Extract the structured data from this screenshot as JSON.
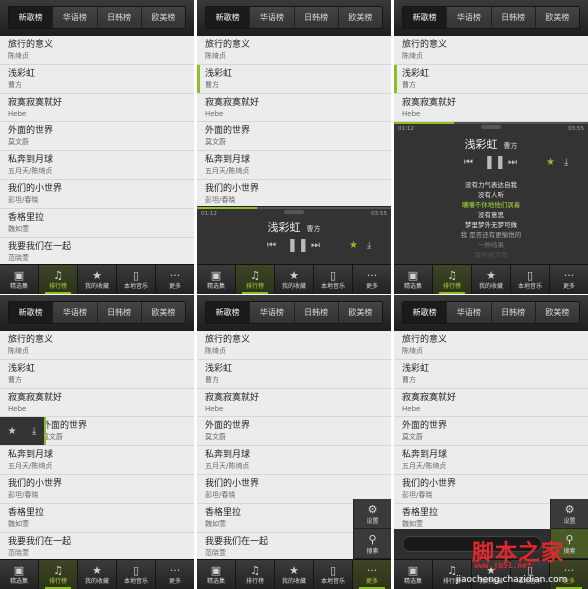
{
  "tabs": [
    "新歌榜",
    "华语榜",
    "日韩榜",
    "欧美榜"
  ],
  "active_tab": 0,
  "songs": [
    {
      "title": "旅行的意义",
      "artist": "陈绮贞"
    },
    {
      "title": "浅彩虹",
      "artist": "曹方"
    },
    {
      "title": "寂寞寂寞就好",
      "artist": "Hebe"
    },
    {
      "title": "外面的世界",
      "artist": "莫文蔚"
    },
    {
      "title": "私奔到月球",
      "artist": "五月天/陈绮贞"
    },
    {
      "title": "我们的小世界",
      "artist": "彭坦/春晓"
    },
    {
      "title": "香格里拉",
      "artist": "魏如萱"
    },
    {
      "title": "我要我们在一起",
      "artist": "范晓萱"
    }
  ],
  "bottom_nav": [
    {
      "label": "精选集",
      "icon": "folder-star-icon"
    },
    {
      "label": "排行榜",
      "icon": "music-note-icon"
    },
    {
      "label": "我的收藏",
      "icon": "star-icon"
    },
    {
      "label": "本地音乐",
      "icon": "music-player-icon"
    },
    {
      "label": "更多",
      "icon": "more-dots-icon"
    }
  ],
  "player": {
    "title": "浅彩虹",
    "artist": "曹方",
    "elapsed": "01:12",
    "total": "03:55",
    "progress_fraction": 0.31,
    "favorited": true
  },
  "lyrics": [
    "没有力气表达自我",
    "没有人听",
    "嘈嘈不休地他们讽着",
    "没有意思",
    "梦里梦外无梦可做",
    "我 是否还有更愉悦的",
    "一种结果",
    "有时候下雨"
  ],
  "current_lyric_index": 2,
  "more_menu": [
    {
      "label": "设置",
      "icon": "gear-icon"
    },
    {
      "label": "搜索",
      "icon": "search-icon"
    }
  ],
  "watermark": {
    "main": "脚本之家",
    "url": "www.jb51.net",
    "sub": "jiaocheng.chazidian.com"
  },
  "colors": {
    "accent": "#8cbf26",
    "bar": "#2a2a2a",
    "list_bg": "#ececec"
  }
}
